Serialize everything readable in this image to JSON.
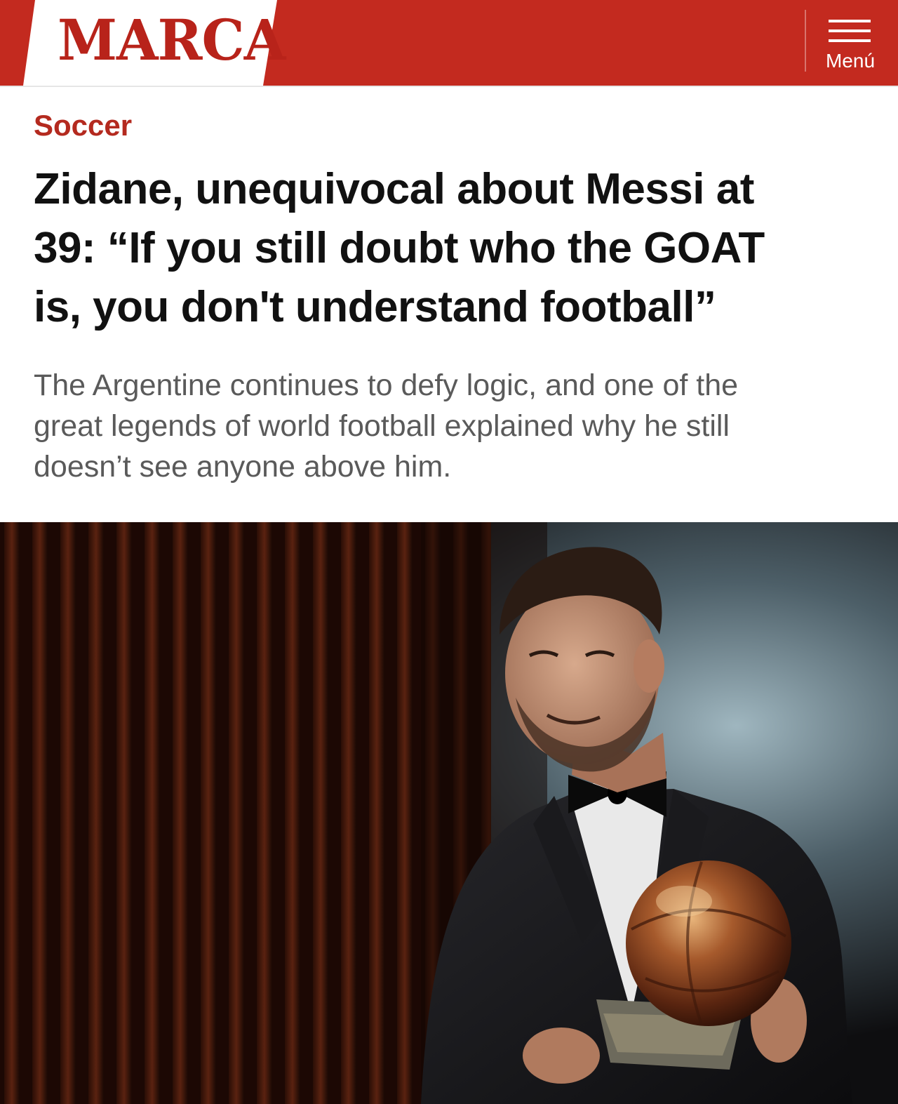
{
  "header": {
    "logo": "MARCA",
    "menu_label": "Menú",
    "brand_color": "#c32a1f",
    "menu_icon": "hamburger-icon"
  },
  "article": {
    "section": "Soccer",
    "headline_lines": [
      "Zidane, unequivocal about Messi at",
      "39: “If you still doubt who the GOAT",
      "is, you don't understand football”"
    ],
    "subtitle_lines": [
      "The Argentine continues to defy logic, and one of the",
      "great legends of world football explained why he still",
      "doesn’t see anyone above him."
    ],
    "section_color": "#b42a1f"
  }
}
